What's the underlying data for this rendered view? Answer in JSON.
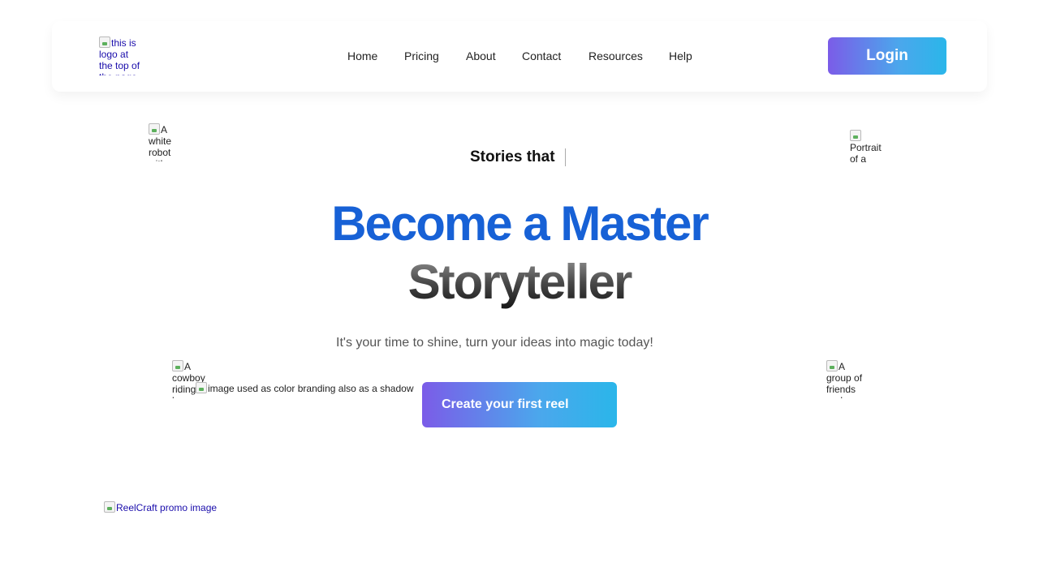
{
  "header": {
    "logo_alt": "this is logo at the top of the page",
    "nav": [
      "Home",
      "Pricing",
      "About",
      "Contact",
      "Resources",
      "Help"
    ],
    "login_label": "Login"
  },
  "hero": {
    "tagline": "Stories that",
    "headline_line1": "Become a Master",
    "headline_line2": "Storyteller",
    "subtitle": "It's your time to shine, turn your ideas into magic today!",
    "cta_label": "Create your first reel",
    "floating_images": {
      "top_left_alt": "A white robot with a",
      "top_right_alt": "Portrait of a wom",
      "bottom_left_alt": "A cowboy riding a ho",
      "bottom_right_alt": "A group of friends and",
      "shadow_alt": "image used as color branding also as a shadow"
    },
    "promo_alt": "ReelCraft promo image"
  },
  "colors": {
    "headline_blue": "#1761d6",
    "gradient_start": "#7b5ce8",
    "gradient_end": "#2ab6ea"
  }
}
